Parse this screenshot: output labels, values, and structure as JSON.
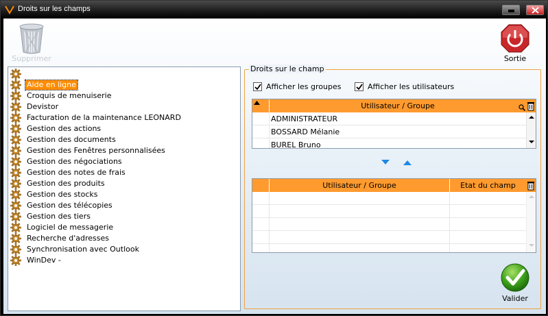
{
  "window": {
    "title": "Droits sur les champs"
  },
  "toolbar": {
    "delete_label": "Supprimer",
    "exit_label": "Sortie"
  },
  "tree": {
    "items": [
      "",
      "Aide en ligne",
      "Croquis de menuiserie",
      "Devistor",
      "Facturation de la maintenance LEONARD",
      "Gestion des actions",
      "Gestion des documents",
      "Gestion des Fenêtres personnalisées",
      "Gestion des négociations",
      "Gestion des notes de frais",
      "Gestion des produits",
      "Gestion des stocks",
      "Gestion des télécopies",
      "Gestion des tiers",
      "Logiciel de messagerie",
      "Recherche d'adresses",
      "Synchronisation avec Outlook",
      "WinDev -"
    ],
    "selected_index": 1
  },
  "groupbox": {
    "label": "Droits sur le champ"
  },
  "options": {
    "show_groups": "Afficher les groupes",
    "show_users": "Afficher les utilisateurs"
  },
  "top_table": {
    "header": "Utilisateur / Groupe",
    "rows": [
      "ADMINISTRATEUR",
      "BOSSARD Mélanie",
      "BUREL Bruno"
    ]
  },
  "bottom_table": {
    "headers": [
      "Utilisateur / Groupe",
      "Etat du champ"
    ]
  },
  "footer": {
    "validate_label": "Valider"
  },
  "colors": {
    "accent": "#ff9a2e",
    "selection": "#ff8c00",
    "border_orange": "#f0a040",
    "move_arrow": "#1e88e5"
  }
}
